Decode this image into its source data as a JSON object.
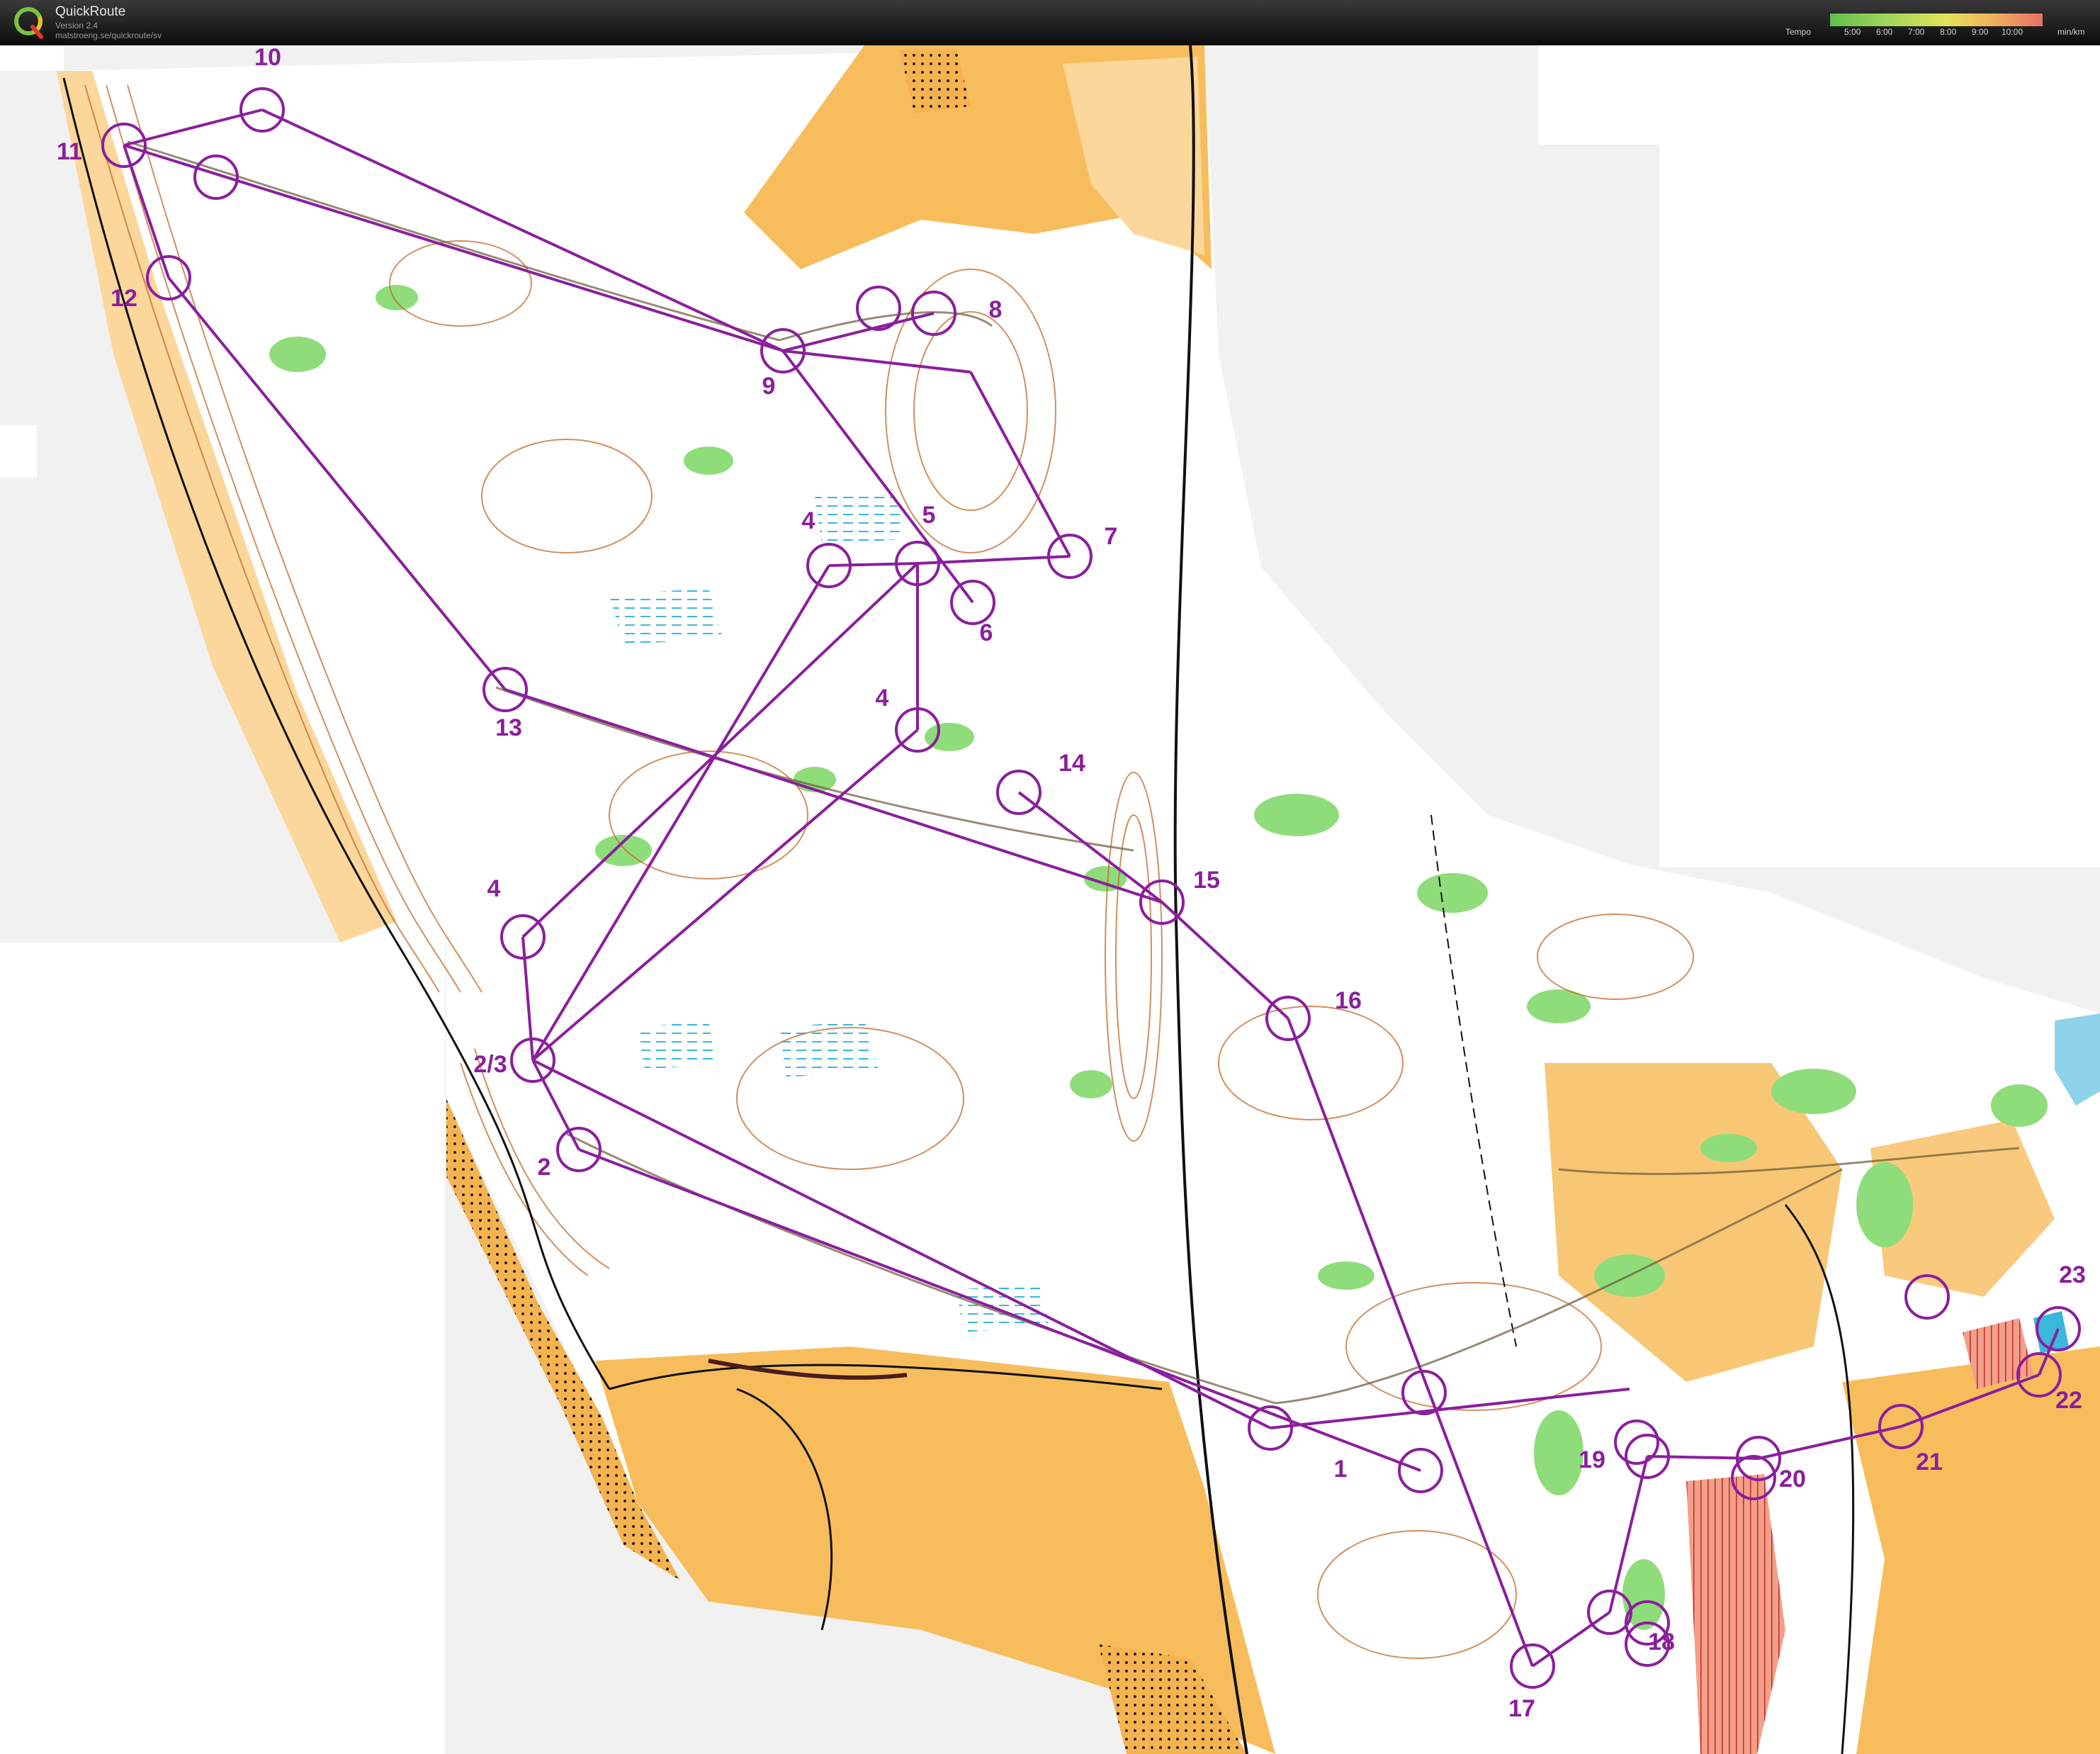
{
  "app": {
    "name": "QuickRoute",
    "version": "Version 2.4",
    "url": "matstroeng.se/quickroute/sv"
  },
  "tempo": {
    "label": "Tempo",
    "ticks": [
      "5:00",
      "6:00",
      "7:00",
      "8:00",
      "9:00",
      "10:00"
    ],
    "unit": "min/km"
  },
  "colors": {
    "course": "#8a1f9c",
    "open_land": "#f7bd5d",
    "forest": "#ffffff",
    "green": "#8fdc7b",
    "contour": "#b5651d",
    "water": "#8ed3ea"
  },
  "controls": [
    {
      "label": "10"
    },
    {
      "label": "11"
    },
    {
      "label": "12"
    },
    {
      "label": "9"
    },
    {
      "label": "8"
    },
    {
      "label": "7"
    },
    {
      "label": "5"
    },
    {
      "label": "4"
    },
    {
      "label": "6"
    },
    {
      "label": "4"
    },
    {
      "label": "13"
    },
    {
      "label": "14"
    },
    {
      "label": "15"
    },
    {
      "label": "4"
    },
    {
      "label": "16"
    },
    {
      "label": "2/3"
    },
    {
      "label": "2"
    },
    {
      "label": "1"
    },
    {
      "label": "19"
    },
    {
      "label": "20"
    },
    {
      "label": "21"
    },
    {
      "label": "23"
    },
    {
      "label": "22"
    },
    {
      "label": "18"
    },
    {
      "label": "17"
    }
  ]
}
